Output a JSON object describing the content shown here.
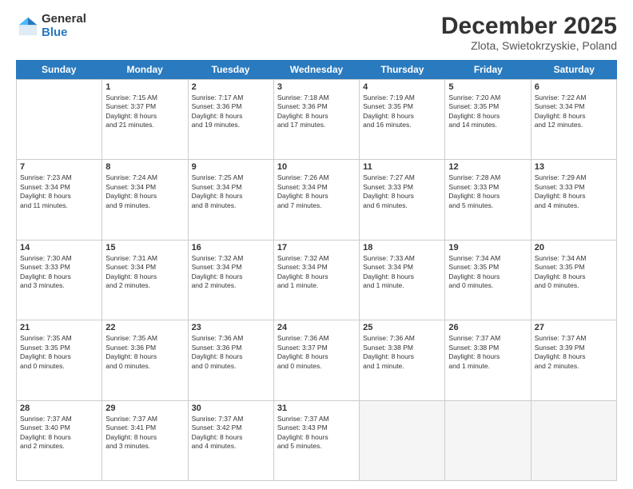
{
  "logo": {
    "general": "General",
    "blue": "Blue"
  },
  "header": {
    "month": "December 2025",
    "location": "Zlota, Swietokrzyskie, Poland"
  },
  "days": [
    "Sunday",
    "Monday",
    "Tuesday",
    "Wednesday",
    "Thursday",
    "Friday",
    "Saturday"
  ],
  "weeks": [
    [
      {
        "day": "",
        "info": ""
      },
      {
        "day": "1",
        "info": "Sunrise: 7:15 AM\nSunset: 3:37 PM\nDaylight: 8 hours\nand 21 minutes."
      },
      {
        "day": "2",
        "info": "Sunrise: 7:17 AM\nSunset: 3:36 PM\nDaylight: 8 hours\nand 19 minutes."
      },
      {
        "day": "3",
        "info": "Sunrise: 7:18 AM\nSunset: 3:36 PM\nDaylight: 8 hours\nand 17 minutes."
      },
      {
        "day": "4",
        "info": "Sunrise: 7:19 AM\nSunset: 3:35 PM\nDaylight: 8 hours\nand 16 minutes."
      },
      {
        "day": "5",
        "info": "Sunrise: 7:20 AM\nSunset: 3:35 PM\nDaylight: 8 hours\nand 14 minutes."
      },
      {
        "day": "6",
        "info": "Sunrise: 7:22 AM\nSunset: 3:34 PM\nDaylight: 8 hours\nand 12 minutes."
      }
    ],
    [
      {
        "day": "7",
        "info": "Sunrise: 7:23 AM\nSunset: 3:34 PM\nDaylight: 8 hours\nand 11 minutes."
      },
      {
        "day": "8",
        "info": "Sunrise: 7:24 AM\nSunset: 3:34 PM\nDaylight: 8 hours\nand 9 minutes."
      },
      {
        "day": "9",
        "info": "Sunrise: 7:25 AM\nSunset: 3:34 PM\nDaylight: 8 hours\nand 8 minutes."
      },
      {
        "day": "10",
        "info": "Sunrise: 7:26 AM\nSunset: 3:34 PM\nDaylight: 8 hours\nand 7 minutes."
      },
      {
        "day": "11",
        "info": "Sunrise: 7:27 AM\nSunset: 3:33 PM\nDaylight: 8 hours\nand 6 minutes."
      },
      {
        "day": "12",
        "info": "Sunrise: 7:28 AM\nSunset: 3:33 PM\nDaylight: 8 hours\nand 5 minutes."
      },
      {
        "day": "13",
        "info": "Sunrise: 7:29 AM\nSunset: 3:33 PM\nDaylight: 8 hours\nand 4 minutes."
      }
    ],
    [
      {
        "day": "14",
        "info": "Sunrise: 7:30 AM\nSunset: 3:33 PM\nDaylight: 8 hours\nand 3 minutes."
      },
      {
        "day": "15",
        "info": "Sunrise: 7:31 AM\nSunset: 3:34 PM\nDaylight: 8 hours\nand 2 minutes."
      },
      {
        "day": "16",
        "info": "Sunrise: 7:32 AM\nSunset: 3:34 PM\nDaylight: 8 hours\nand 2 minutes."
      },
      {
        "day": "17",
        "info": "Sunrise: 7:32 AM\nSunset: 3:34 PM\nDaylight: 8 hours\nand 1 minute."
      },
      {
        "day": "18",
        "info": "Sunrise: 7:33 AM\nSunset: 3:34 PM\nDaylight: 8 hours\nand 1 minute."
      },
      {
        "day": "19",
        "info": "Sunrise: 7:34 AM\nSunset: 3:35 PM\nDaylight: 8 hours\nand 0 minutes."
      },
      {
        "day": "20",
        "info": "Sunrise: 7:34 AM\nSunset: 3:35 PM\nDaylight: 8 hours\nand 0 minutes."
      }
    ],
    [
      {
        "day": "21",
        "info": "Sunrise: 7:35 AM\nSunset: 3:35 PM\nDaylight: 8 hours\nand 0 minutes."
      },
      {
        "day": "22",
        "info": "Sunrise: 7:35 AM\nSunset: 3:36 PM\nDaylight: 8 hours\nand 0 minutes."
      },
      {
        "day": "23",
        "info": "Sunrise: 7:36 AM\nSunset: 3:36 PM\nDaylight: 8 hours\nand 0 minutes."
      },
      {
        "day": "24",
        "info": "Sunrise: 7:36 AM\nSunset: 3:37 PM\nDaylight: 8 hours\nand 0 minutes."
      },
      {
        "day": "25",
        "info": "Sunrise: 7:36 AM\nSunset: 3:38 PM\nDaylight: 8 hours\nand 1 minute."
      },
      {
        "day": "26",
        "info": "Sunrise: 7:37 AM\nSunset: 3:38 PM\nDaylight: 8 hours\nand 1 minute."
      },
      {
        "day": "27",
        "info": "Sunrise: 7:37 AM\nSunset: 3:39 PM\nDaylight: 8 hours\nand 2 minutes."
      }
    ],
    [
      {
        "day": "28",
        "info": "Sunrise: 7:37 AM\nSunset: 3:40 PM\nDaylight: 8 hours\nand 2 minutes."
      },
      {
        "day": "29",
        "info": "Sunrise: 7:37 AM\nSunset: 3:41 PM\nDaylight: 8 hours\nand 3 minutes."
      },
      {
        "day": "30",
        "info": "Sunrise: 7:37 AM\nSunset: 3:42 PM\nDaylight: 8 hours\nand 4 minutes."
      },
      {
        "day": "31",
        "info": "Sunrise: 7:37 AM\nSunset: 3:43 PM\nDaylight: 8 hours\nand 5 minutes."
      },
      {
        "day": "",
        "info": ""
      },
      {
        "day": "",
        "info": ""
      },
      {
        "day": "",
        "info": ""
      }
    ]
  ]
}
